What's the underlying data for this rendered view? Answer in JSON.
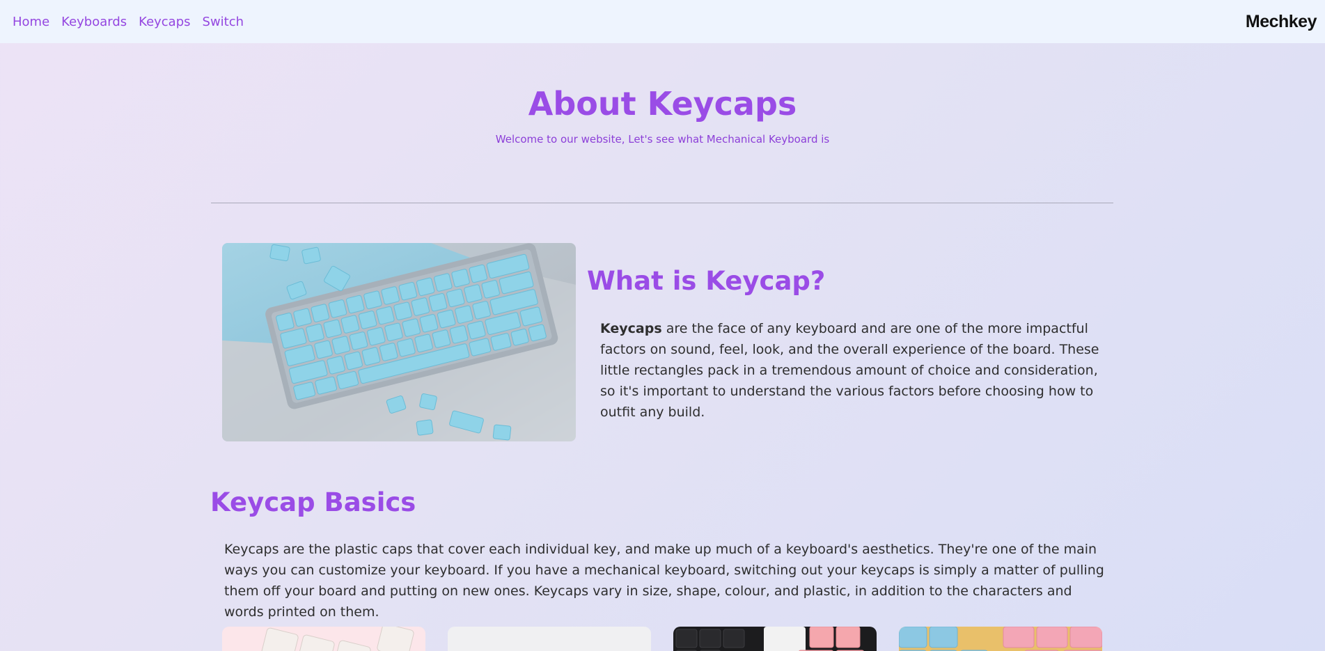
{
  "nav": {
    "links": [
      "Home",
      "Keyboards",
      "Keycaps",
      "Switch"
    ],
    "brand": "Mechkey"
  },
  "hero": {
    "title": "About Keycaps",
    "subtitle": "Welcome to our website, Let's see what Mechanical Keyboard is"
  },
  "what_is": {
    "heading": "What is Keycap?",
    "lead_bold": "Keycaps",
    "body": " are the face of any keyboard and are one of the more impactful factors on sound, feel, look, and the overall experience of the board. These little rectangles pack in a tremendous amount of choice and consideration, so it's important to understand the various factors before choosing how to outfit any build."
  },
  "basics": {
    "heading": "Keycap Basics",
    "body": "Keycaps are the plastic caps that cover each individual key, and make up much of a keyboard's aesthetics. They're one of the main ways you can customize your keyboard. If you have a mechanical keyboard, switching out your keycaps is simply a matter of pulling them off your board and putting on new ones. Keycaps vary in size, shape, colour, and plastic, in addition to the characters and words printed on them."
  },
  "colors": {
    "accent": "#9a4ce6",
    "nav_bg": "#eef4fe",
    "keycap_blue": "#8fd3e8"
  },
  "images": {
    "hero_photo": "blue-keycap-keyboard-image",
    "cards": [
      "white-keycaps-image",
      "gray-keycaps-image",
      "black-pink-keycaps-image",
      "pastel-keycaps-image"
    ]
  }
}
